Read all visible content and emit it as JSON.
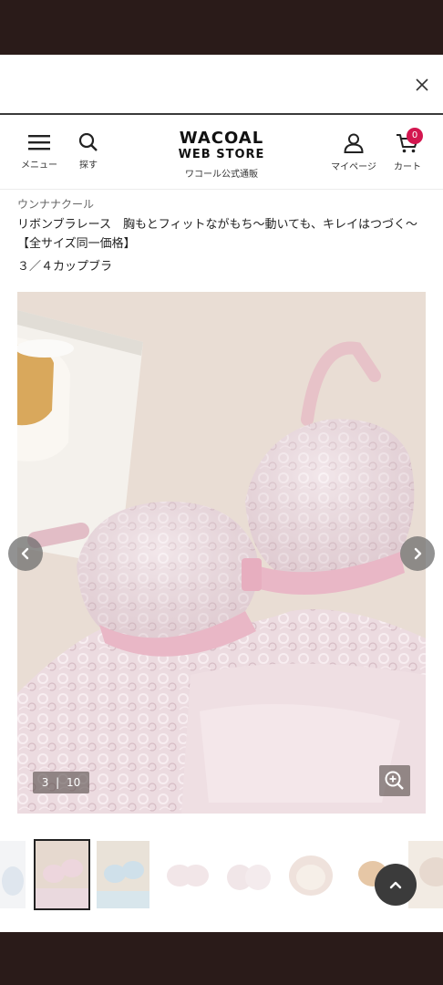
{
  "header": {
    "menu_label": "メニュー",
    "search_label": "探す",
    "logo_line1": "WACOAL",
    "logo_line2": "WEB STORE",
    "logo_sub": "ワコール公式通販",
    "mypage_label": "マイページ",
    "cart_label": "カート",
    "cart_count": "0"
  },
  "product": {
    "brand": "ウンナナクール",
    "title": "リボンブラレース　胸もとフィットながもち〜動いても、キレイはつづく〜【全サイズ同一価格】",
    "subtitle": "３／４カップブラ"
  },
  "gallery": {
    "current": "3",
    "separator": "|",
    "total": "10"
  },
  "icons": {
    "close": "close-icon",
    "menu": "hamburger-icon",
    "search": "search-icon",
    "mypage": "user-icon",
    "cart": "cart-icon",
    "zoom": "zoom-in-icon",
    "prev": "chevron-left-icon",
    "next": "chevron-right-icon",
    "to_top": "chevron-up-icon"
  },
  "colors": {
    "badge": "#d3164f",
    "frame_bar": "#2a1b19"
  }
}
